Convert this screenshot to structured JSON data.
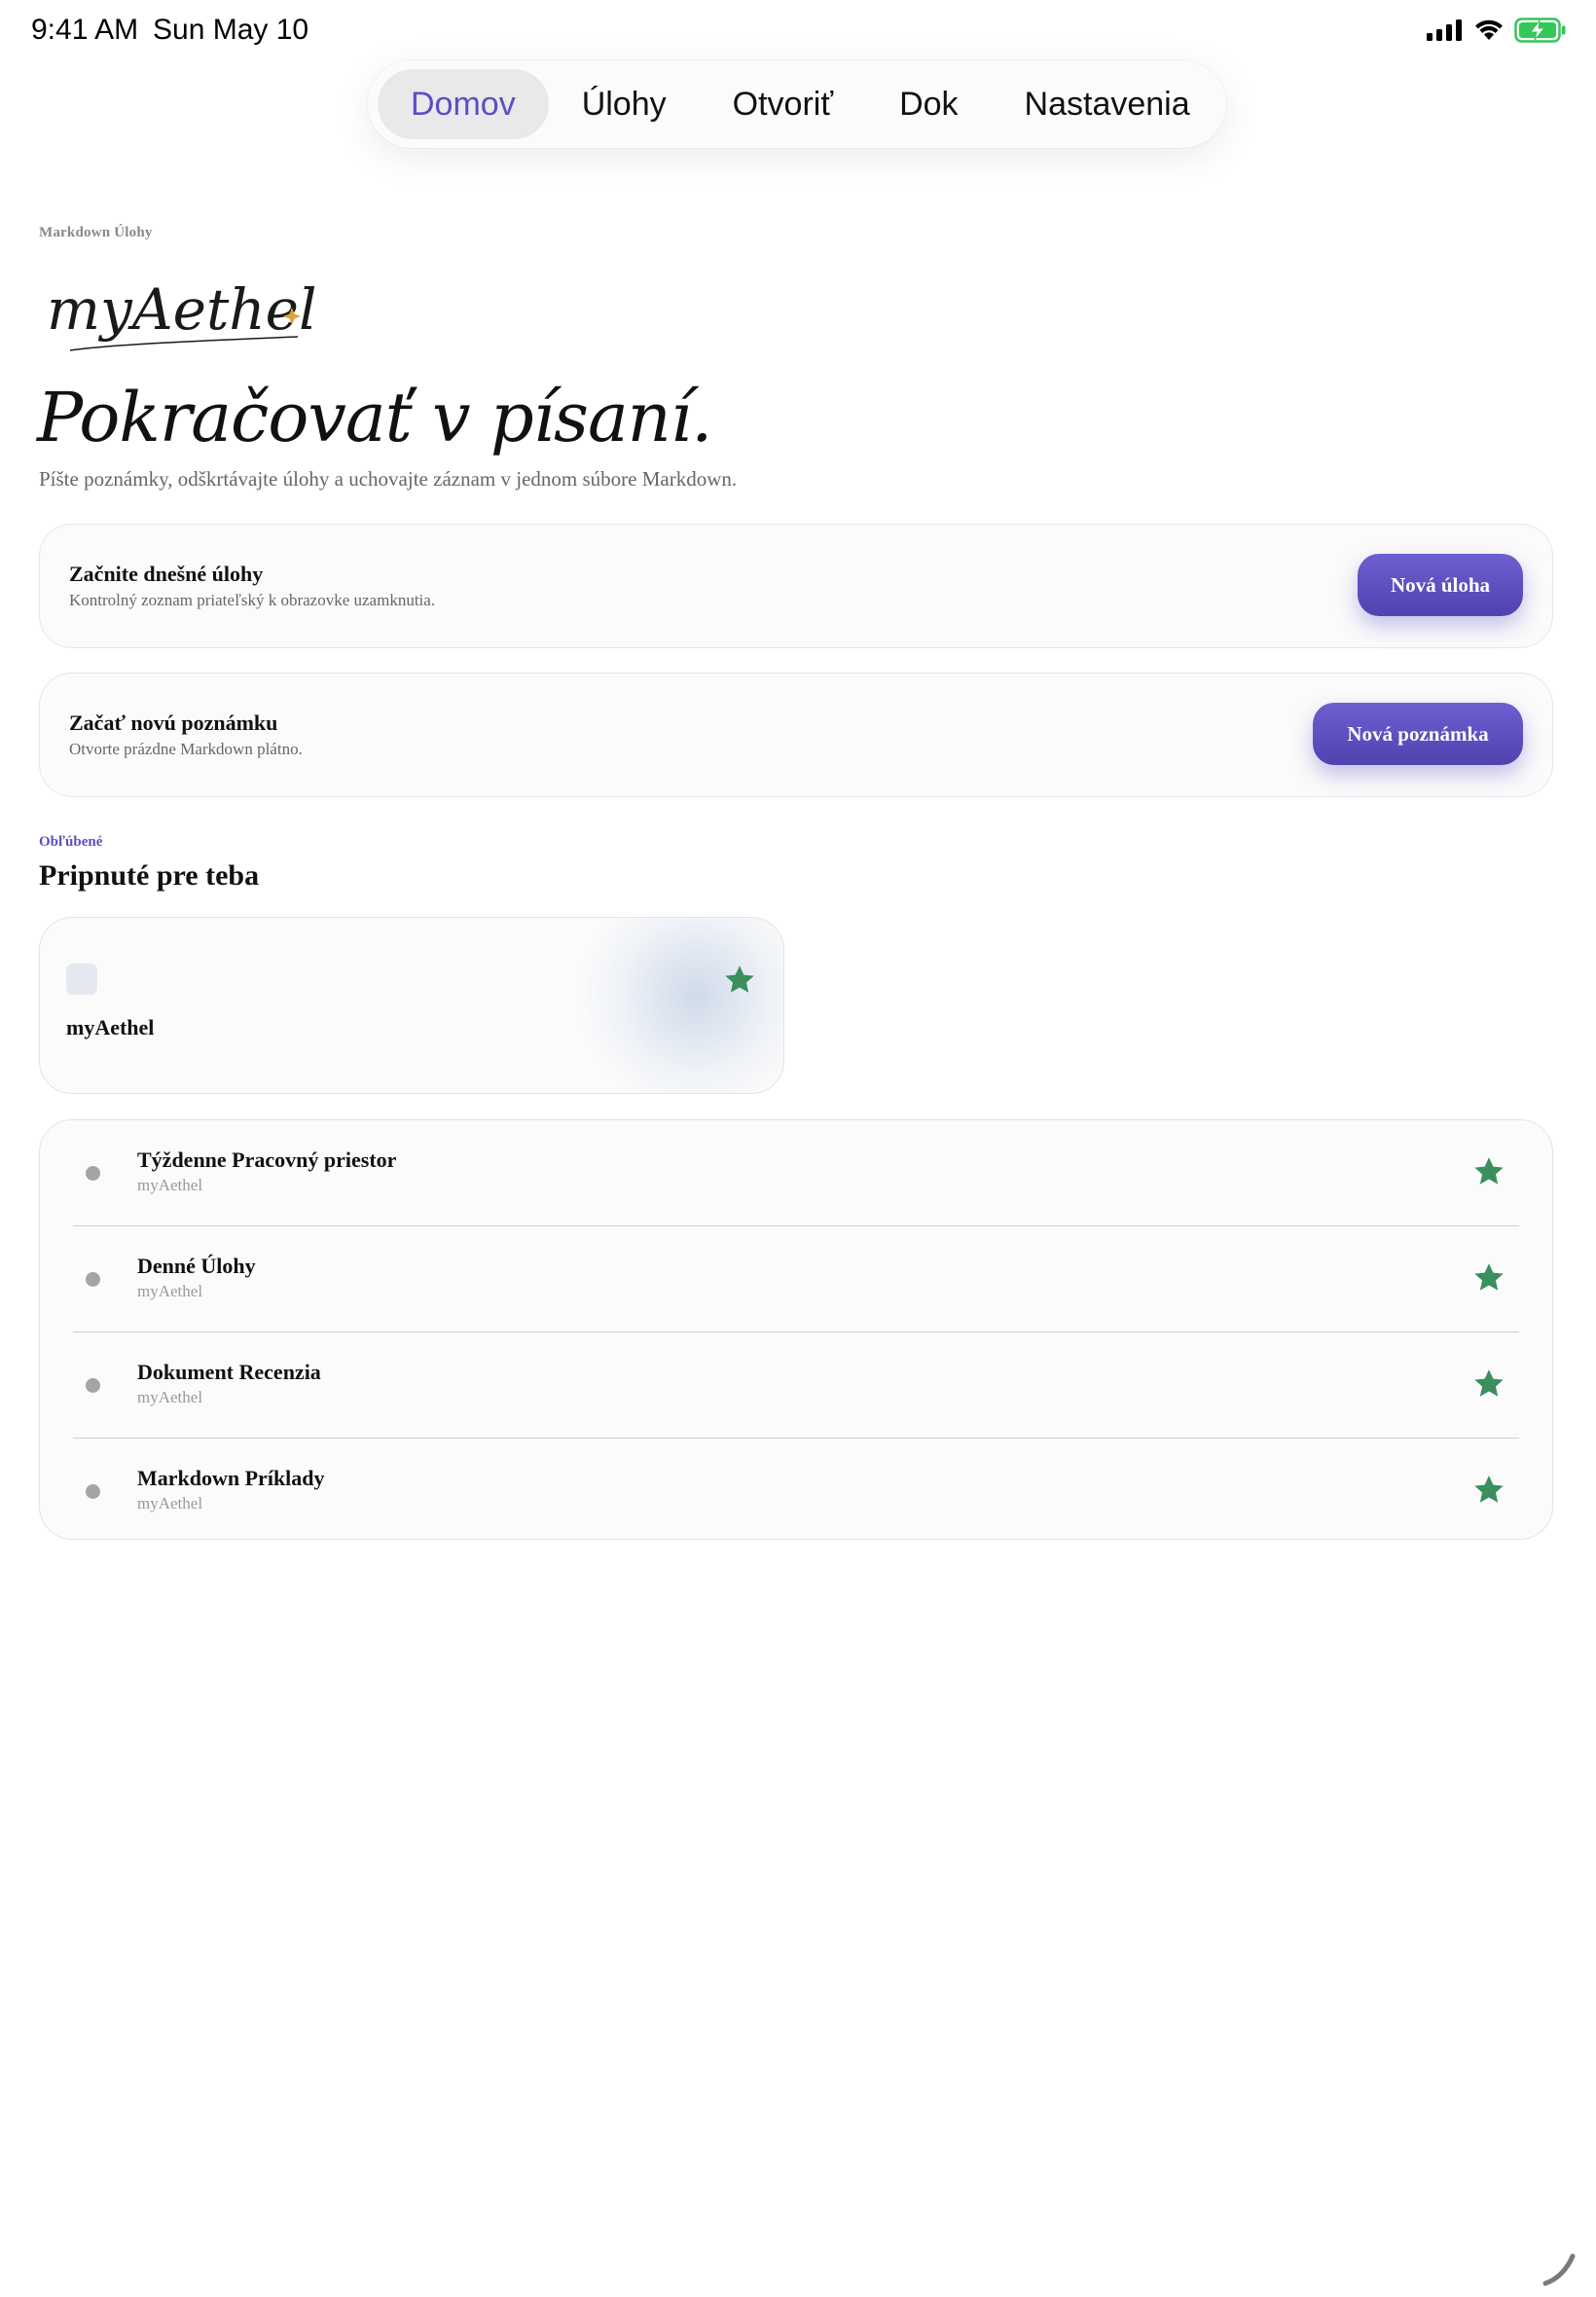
{
  "status_bar": {
    "time": "9:41 AM",
    "date": "Sun May 10",
    "battery_color": "#34c759"
  },
  "nav": {
    "tabs": [
      {
        "label": "Domov",
        "active": true
      },
      {
        "label": "Úlohy",
        "active": false
      },
      {
        "label": "Otvoriť",
        "active": false
      },
      {
        "label": "Dok",
        "active": false
      },
      {
        "label": "Nastavenia",
        "active": false
      }
    ]
  },
  "header": {
    "breadcrumb": "Markdown Úlohy",
    "logo_text": "myAethel",
    "headline": "Pokračovať v písaní.",
    "subtitle": "Píšte poznámky, odškrtávajte úlohy a uchovajte záznam v jednom súbore Markdown."
  },
  "actions": {
    "tasks": {
      "title": "Začnite dnešné úlohy",
      "description": "Kontrolný zoznam priateľský k obrazovke uzamknutia.",
      "button_label": "Nová úloha"
    },
    "note": {
      "title": "Začať novú poznámku",
      "description": "Otvorte prázdne Markdown plátno.",
      "button_label": "Nová poznámka"
    }
  },
  "favorites": {
    "label": "Obľúbené",
    "title": "Pripnuté pre teba",
    "pinned": {
      "name": "myAethel",
      "starred": true
    },
    "items": [
      {
        "title": "Týždenne Pracovný priestor",
        "subtitle": "myAethel",
        "starred": true
      },
      {
        "title": "Denné Úlohy",
        "subtitle": "myAethel",
        "starred": true
      },
      {
        "title": "Dokument Recenzia",
        "subtitle": "myAethel",
        "starred": true
      },
      {
        "title": "Markdown Príklady",
        "subtitle": "myAethel",
        "starred": true
      }
    ]
  },
  "colors": {
    "accent": "#5a4fc4",
    "star": "#3a8f5c",
    "logo_sparkle": "#d9a43a"
  }
}
